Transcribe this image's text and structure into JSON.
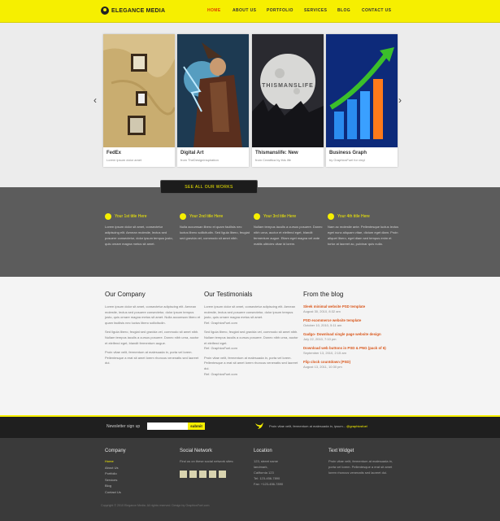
{
  "header": {
    "logo_text": "ELEGANCE MEDIA",
    "nav": [
      {
        "label": "HOME",
        "active": true
      },
      {
        "label": "ABOUT US",
        "active": false
      },
      {
        "label": "PORTFOLIO",
        "active": false
      },
      {
        "label": "SERVICES",
        "active": false
      },
      {
        "label": "BLOG",
        "active": false
      },
      {
        "label": "CONTACT US",
        "active": false
      }
    ]
  },
  "slider": {
    "cards": [
      {
        "title": "FedEx",
        "subtitle": "Lorem ipsum dolor amet"
      },
      {
        "title": "Digital Art",
        "subtitle": "from TheDesignInspiration"
      },
      {
        "title": "Thismanslife: New",
        "subtitle": "from Creattica by this life"
      },
      {
        "title": "Business Graph",
        "subtitle": "by GraphicsFuel for vinyl"
      }
    ],
    "card3_overlay": "THISMANSLIFE"
  },
  "works_button": "SEE ALL OUR WORKS",
  "features": [
    {
      "title": "Your 1st title Here",
      "body": "Lorem ipsum dolor sit amet, consectetur adipiscing elit. Aenean molestie, lectus sed posuere consectetur, dolor ipsum tempus justo, quis ornare magna metus sit amet."
    },
    {
      "title": "Your 2nd title Here",
      "body": "Nulla accumsan libero et quam facilisis nec luctus libero sollicitudin. Sed ligula libero, feugiat sed gravida vel, commodo sit amet nibh."
    },
    {
      "title": "Your 3rd title Here",
      "body": "Nullam tempus iaculis a cursus posuere. Donec nibh urna, auctor et eleifend eget, blandit fermentum augue. Etiam eget magna vel ante mattis ultricies vitae id lorem."
    },
    {
      "title": "Your 4th title Here",
      "body": "Nam ac molestie ante. Pellentesque luctus lectus eget nunc aliquam vitae, dictum eget diam. Proin aliquet libero, eget diam sed tempus enim et tortor at laoreet ac, pulvinar quis nulla."
    }
  ],
  "company": {
    "heading": "Our Company",
    "paragraphs": [
      "Lorem ipsum dolor sit amet, consectetur adipiscing elit. Aenean molestie, lectus sed posuere consectetur, dolor ipsum tempus justo, quis ornare magna metus sit amet. Nulla accumsan libero et quam facilisis nec luctus libero sollicitudin.",
      "Sed ligula libero, feugiat sed gravida vel, commodo sit amet nibh. Nullam tempus iaculis a cursus posuere. Donec nibh urna, auctor et eleifend eget, blandit fermentum augue.",
      "Proin vitae velit, fermentum at malesuada in, porta vel lorem. Pellentesque a erat sit amet lorem rhoncus venenatis sed laoreet dui."
    ]
  },
  "testimonials": {
    "heading": "Our Testimonials",
    "items": [
      {
        "text": "Lorem ipsum dolor sit amet, consectetur adipiscing elit. Aenean molestie, lectus sed posuere consectetur, dolor ipsum tempus justo, quis ornare magna metus sit amet.",
        "author": "Ref. GraphicsFuel.com"
      },
      {
        "text": "Sed ligula libero, feugiat sed gravida vel, commodo sit amet nibh. Nullam tempus iaculis a cursus posuere. Donec nibh urna, auctor et eleifend eget.",
        "author": "Ref. GraphicsFuel.com"
      },
      {
        "text": "Proin vitae velit, fermentum at malesuada in, porta vel lorem. Pellentesque a erat sit amet lorem rhoncus venenatis sed laoreet dui.",
        "author": "Ref. GraphicsFuel.com"
      }
    ]
  },
  "blog": {
    "heading": "From the blog",
    "items": [
      {
        "title": "Sleek minimal website PSD template",
        "date": "August 30, 2010, 8:32 am"
      },
      {
        "title": "PSD ecommerce website template",
        "date": "October 10, 2010, 5:11 am"
      },
      {
        "title": "Gadgo- Download single page website design",
        "date": "July 22, 2010, 7:10 pm"
      },
      {
        "title": "Download web buttons in PSD & PNG (pack of 6)",
        "date": "September 13, 2010, 2:15 am"
      },
      {
        "title": "Flip clock countdown (PSD)",
        "date": "August 13, 2011, 10:30 pm"
      }
    ]
  },
  "newsletter": {
    "label": "Newsletter sign up",
    "input_value": "",
    "submit_label": "submit",
    "tweet_text": "Proin vitae velit, fermentum at malesuada in, ipsum...",
    "tweet_handle": "@graphicsfuel"
  },
  "footer": {
    "company": {
      "heading": "Company",
      "links": [
        {
          "label": "Home",
          "active": true
        },
        {
          "label": "About Us",
          "active": false
        },
        {
          "label": "Portfolio",
          "active": false
        },
        {
          "label": "Services",
          "active": false
        },
        {
          "label": "Blog",
          "active": false
        },
        {
          "label": "Contact Us",
          "active": false
        }
      ]
    },
    "social": {
      "heading": "Social Network",
      "text": "Find us on these social network sites:"
    },
    "location": {
      "heading": "Location",
      "lines": [
        "123, street name",
        "landmark,",
        "California 123",
        "Tel: 123-456-7890",
        "Fax: +123-456-7890"
      ]
    },
    "text_widget": {
      "heading": "Text Widget",
      "body": "Proin vitae velit, fermentum at malesuada in, porta vel lorem. Pellentesque a erat sit amet lorem rhoncus venenatis sed laoreet dui."
    },
    "copyright": "Copyright © 2010 Elegance Media. All rights reserved. Design by GraphicsFuel.com"
  },
  "colors": {
    "accent": "#f6ef00",
    "nav_active": "#e03b00",
    "blog_title": "#d9561a",
    "band": "#5c5c5c",
    "footer": "#3a3a3a"
  }
}
